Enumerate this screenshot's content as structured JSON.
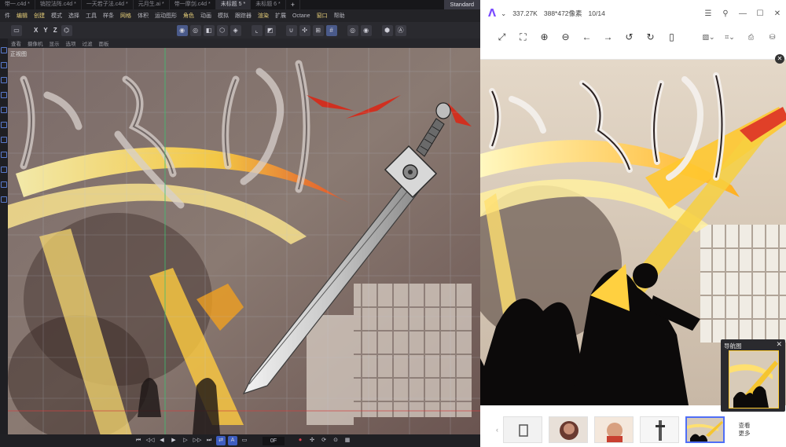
{
  "c4d": {
    "tabs": [
      "带一.c4d *",
      "销控法阵.c4d *",
      "一天若子法.c4d *",
      "元月生.ai *",
      "带一摩剑.c4d *",
      "未标题 5 *",
      "未标题 6 *"
    ],
    "active_tab_index": 5,
    "new_tab": "+",
    "layout_label": "Standard",
    "menu": [
      {
        "label": "件",
        "hl": false
      },
      {
        "label": "编辑",
        "hl": true
      },
      {
        "label": "创建",
        "hl": true
      },
      {
        "label": "模式",
        "hl": false
      },
      {
        "label": "选择",
        "hl": false
      },
      {
        "label": "工具",
        "hl": false
      },
      {
        "label": "样条",
        "hl": false
      },
      {
        "label": "网格",
        "hl": true
      },
      {
        "label": "体积",
        "hl": false
      },
      {
        "label": "运动图形",
        "hl": false
      },
      {
        "label": "角色",
        "hl": true
      },
      {
        "label": "动画",
        "hl": false
      },
      {
        "label": "模拟",
        "hl": false
      },
      {
        "label": "跟踪器",
        "hl": false
      },
      {
        "label": "渲染",
        "hl": true
      },
      {
        "label": "扩展",
        "hl": false
      },
      {
        "label": "Octane",
        "hl": false
      },
      {
        "label": "窗口",
        "hl": true
      },
      {
        "label": "帮助",
        "hl": false
      }
    ],
    "toolbar": {
      "x": "X",
      "y": "Y",
      "z": "Z"
    },
    "view_menu": [
      "查看",
      "摄像机",
      "显示",
      "选项",
      "过滤",
      "面板"
    ],
    "viewport_label": "正视图",
    "frame_field": "0F"
  },
  "viewer": {
    "size_text": "337.27K",
    "dimensions_text": "388*472像素",
    "page_text": "10/14",
    "nav_title": "导航图",
    "more_label": "查看更多"
  },
  "colors": {
    "c4d_bg": "#2b2b30",
    "accent_blue": "#4f6ef7",
    "viewer_logo": "#7b4dff",
    "highlight_yellow": "#e8d07a"
  }
}
